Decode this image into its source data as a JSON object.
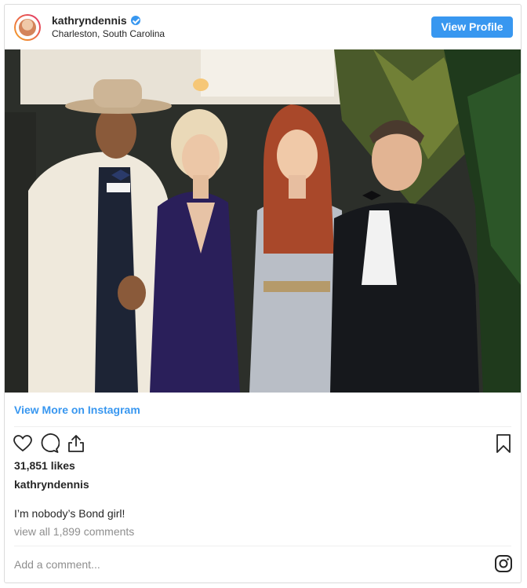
{
  "header": {
    "username": "kathryndennis",
    "location": "Charleston, South Carolina",
    "view_profile_label": "View Profile"
  },
  "post": {
    "view_more_label": "View More on Instagram",
    "likes": "31,851 likes",
    "caption_username": "kathryndennis",
    "caption_text": "I’m nobody’s Bond girl!",
    "comments_link": "view all 1,899 comments",
    "add_comment_placeholder": "Add a comment..."
  },
  "icons": {
    "verified": "verified-badge-icon",
    "like": "heart-icon",
    "comment": "comment-icon",
    "share": "share-icon",
    "save": "bookmark-icon",
    "brand": "instagram-icon"
  },
  "colors": {
    "accent": "#3897f0",
    "text": "#262626",
    "muted": "#8e8e8e",
    "border": "#dbdbdb"
  }
}
